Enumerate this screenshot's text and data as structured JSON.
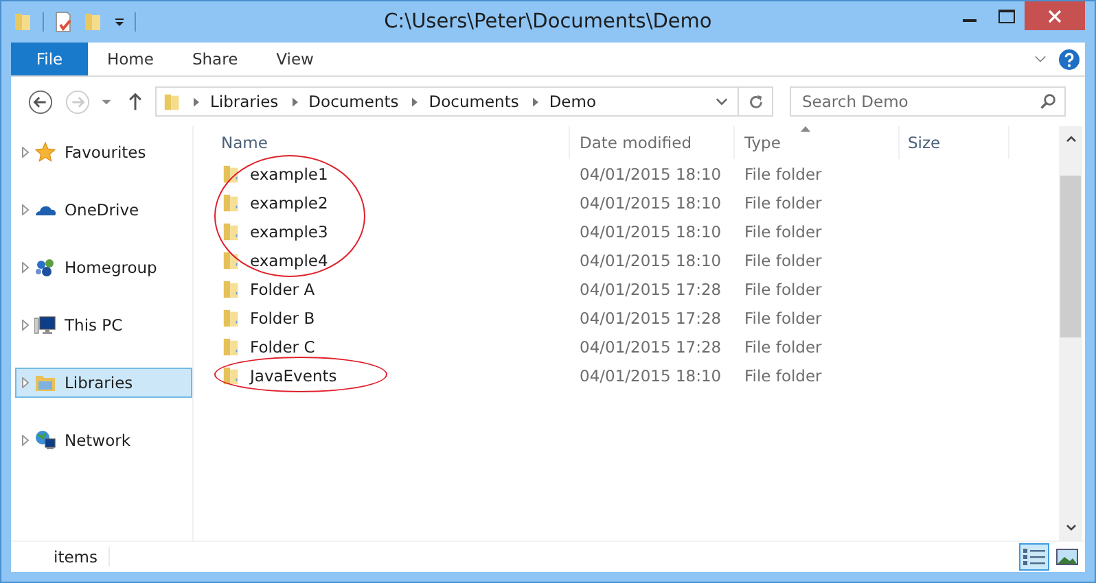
{
  "window": {
    "title": "C:\\Users\\Peter\\Documents\\Demo"
  },
  "ribbon_tabs": [
    {
      "label": "File",
      "selected": true
    },
    {
      "label": "Home",
      "selected": false
    },
    {
      "label": "Share",
      "selected": false
    },
    {
      "label": "View",
      "selected": false
    }
  ],
  "address": {
    "segments": [
      "Libraries",
      "Documents",
      "Documents",
      "Demo"
    ]
  },
  "search": {
    "placeholder": "Search Demo"
  },
  "sidebar": {
    "items": [
      {
        "label": "Favourites",
        "kind": "star",
        "selected": false
      },
      {
        "label": "OneDrive",
        "kind": "cloud",
        "selected": false
      },
      {
        "label": "Homegroup",
        "kind": "homegroup",
        "selected": false
      },
      {
        "label": "This PC",
        "kind": "pc",
        "selected": false
      },
      {
        "label": "Libraries",
        "kind": "library",
        "selected": true
      },
      {
        "label": "Network",
        "kind": "network",
        "selected": false
      }
    ]
  },
  "table": {
    "columns": [
      "Name",
      "Date modified",
      "Type",
      "Size"
    ],
    "rows": [
      {
        "name": "example1",
        "date": "04/01/2015 18:10",
        "type": "File folder",
        "circled": true
      },
      {
        "name": "example2",
        "date": "04/01/2015 18:10",
        "type": "File folder",
        "circled": true
      },
      {
        "name": "example3",
        "date": "04/01/2015 18:10",
        "type": "File folder",
        "circled": true
      },
      {
        "name": "example4",
        "date": "04/01/2015 18:10",
        "type": "File folder",
        "circled": true
      },
      {
        "name": "Folder A",
        "date": "04/01/2015 17:28",
        "type": "File folder",
        "circled": false
      },
      {
        "name": "Folder B",
        "date": "04/01/2015 17:28",
        "type": "File folder",
        "circled": false
      },
      {
        "name": "Folder C",
        "date": "04/01/2015 17:28",
        "type": "File folder",
        "circled": false
      },
      {
        "name": "JavaEvents",
        "date": "04/01/2015 18:10",
        "type": "File folder",
        "circled": true
      }
    ]
  },
  "status_bar": {
    "text": "items",
    "views": [
      {
        "kind": "details",
        "selected": true
      },
      {
        "kind": "large",
        "selected": false
      }
    ]
  }
}
